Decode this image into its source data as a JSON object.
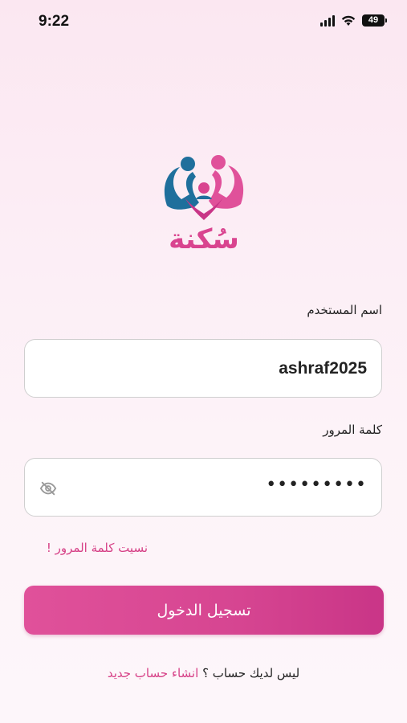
{
  "status_bar": {
    "time": "9:22",
    "battery": "49"
  },
  "brand": {
    "name": "سُكنة",
    "colors": {
      "pink": "#d9448f",
      "blue": "#1f6f9c"
    }
  },
  "form": {
    "username_label": "اسم المستخدم",
    "username_value": "ashraf2025",
    "password_label": "كلمة المرور",
    "password_value": "•••••••••",
    "forgot_link": "نسيت كلمة المرور !",
    "login_button": "تسجيل الدخول"
  },
  "footer": {
    "no_account_text": "ليس لديك حساب ؟",
    "create_account_link": "انشاء حساب جديد"
  }
}
